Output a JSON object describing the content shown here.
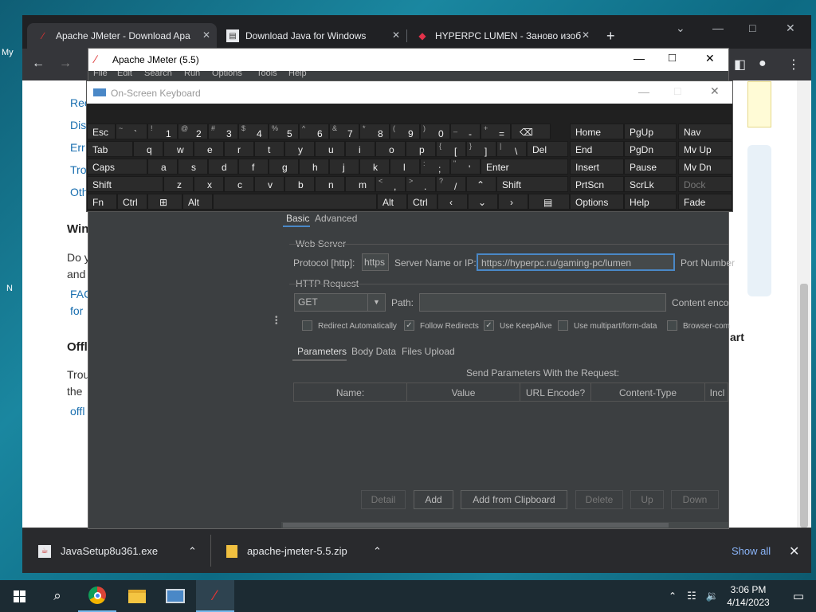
{
  "desktop": {
    "frag_my": "My",
    "frag_n": "N"
  },
  "browser": {
    "tabs": [
      {
        "label": "Apache JMeter - Download Apa"
      },
      {
        "label": "Download Java for Windows"
      },
      {
        "label": "HYPERPC LUMEN - Заново изоб"
      }
    ],
    "page": {
      "links": [
        "Rec",
        "Dis",
        "Err",
        "Tro",
        "Oth"
      ],
      "heading1": "Win",
      "para1_l1": "Do y",
      "para1_l2": "and",
      "link2_l1": "FAC",
      "link2_l2": "for",
      "heading2": "Offl",
      "para2_l1": "Trou",
      "para2_l2": "the",
      "link3": "offl",
      "right_frag": "art"
    },
    "downloads": {
      "items": [
        {
          "name": "JavaSetup8u361.exe"
        },
        {
          "name": "apache-jmeter-5.5.zip"
        }
      ],
      "show_all": "Show all"
    }
  },
  "jmeter": {
    "title": "Apache JMeter (5.5)",
    "menu": [
      "File",
      "Edit",
      "Search",
      "Run",
      "Options",
      "Tools",
      "Help"
    ],
    "tabs": {
      "basic": "Basic",
      "advanced": "Advanced"
    },
    "web_server": {
      "section": "Web Server",
      "protocol_label": "Protocol [http]:",
      "protocol_value": "https",
      "server_label": "Server Name or IP:",
      "server_value": "https://hyperpc.ru/gaming-pc/lumen",
      "port_label": "Port Number"
    },
    "http_request": {
      "section": "HTTP Request",
      "method": "GET",
      "path_label": "Path:",
      "path_value": "",
      "content_label": "Content enco"
    },
    "options": {
      "redirect_auto": "Redirect Automatically",
      "follow_redirects": "Follow Redirects",
      "keepalive": "Use KeepAlive",
      "multipart": "Use multipart/form-data",
      "browser_compat": "Browser-com"
    },
    "subtabs": {
      "parameters": "Parameters",
      "body": "Body Data",
      "files": "Files Upload"
    },
    "params_title": "Send Parameters With the Request:",
    "columns": [
      "Name:",
      "Value",
      "URL Encode?",
      "Content-Type",
      "Incl"
    ],
    "buttons": {
      "detail": "Detail",
      "add": "Add",
      "add_clip": "Add from Clipboard",
      "delete": "Delete",
      "up": "Up",
      "down": "Down"
    }
  },
  "osk": {
    "title": "On-Screen Keyboard",
    "row1": [
      "Esc",
      "~ `",
      "! 1",
      "@ 2",
      "# 3",
      "$ 4",
      "% 5",
      "^ 6",
      "& 7",
      "* 8",
      "( 9",
      ") 0",
      "_ -",
      "+ ="
    ],
    "row2": [
      "Tab",
      "q",
      "w",
      "e",
      "r",
      "t",
      "y",
      "u",
      "i",
      "o",
      "p",
      "{ [",
      "} ]",
      "| \\",
      "Del"
    ],
    "row3": [
      "Caps",
      "a",
      "s",
      "d",
      "f",
      "g",
      "h",
      "j",
      "k",
      "l",
      ": ;",
      "\" '",
      "Enter"
    ],
    "row4": [
      "Shift",
      "z",
      "x",
      "c",
      "v",
      "b",
      "n",
      "m",
      "< ,",
      "> .",
      "? /",
      "Shift"
    ],
    "row5": [
      "Fn",
      "Ctrl",
      "Alt",
      "Alt",
      "Ctrl"
    ],
    "nav": {
      "c1": [
        "Home",
        "End",
        "Insert",
        "PrtScn",
        "Options"
      ],
      "c2": [
        "PgUp",
        "PgDn",
        "Pause",
        "ScrLk",
        "Help"
      ],
      "c3": [
        "Nav",
        "Mv Up",
        "Mv Dn",
        "Dock",
        "Fade"
      ]
    }
  },
  "taskbar": {
    "time": "3:06 PM",
    "date": "4/14/2023"
  }
}
